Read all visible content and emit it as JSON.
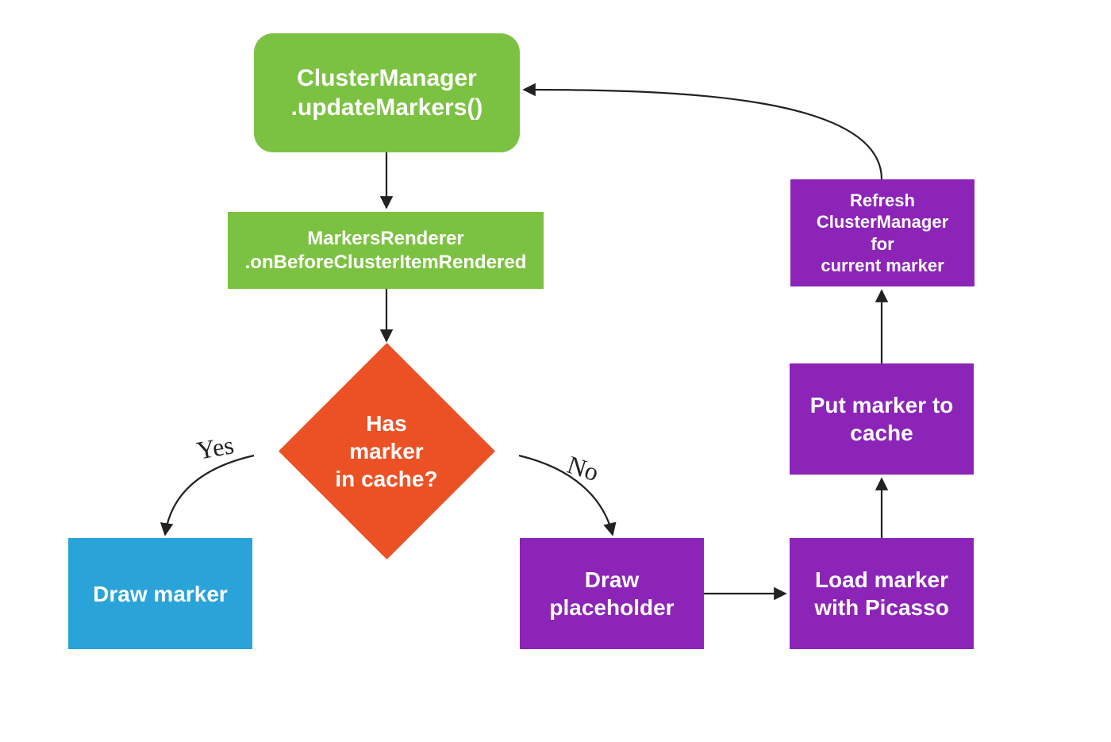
{
  "nodes": {
    "start": {
      "line1": "ClusterManager",
      "line2": ".updateMarkers()"
    },
    "renderer": {
      "line1": "MarkersRenderer",
      "line2": ".onBeforeClusterItemRendered"
    },
    "decision": {
      "line1": "Has",
      "line2": "marker",
      "line3": "in cache?"
    },
    "drawMarker": "Draw marker",
    "drawPlaceholder": {
      "line1": "Draw",
      "line2": "placeholder"
    },
    "loadPicasso": {
      "line1": "Load marker",
      "line2": "with Picasso"
    },
    "putCache": {
      "line1": "Put marker to",
      "line2": "cache"
    },
    "refresh": {
      "line1": "Refresh",
      "line2": "ClusterManager for",
      "line3": "current marker"
    }
  },
  "edges": {
    "yes": "Yes",
    "no": "No"
  },
  "colors": {
    "green": "#7cc242",
    "orange": "#ec5126",
    "purple": "#8c24b8",
    "blue": "#29a3d8",
    "text": "#222222"
  }
}
